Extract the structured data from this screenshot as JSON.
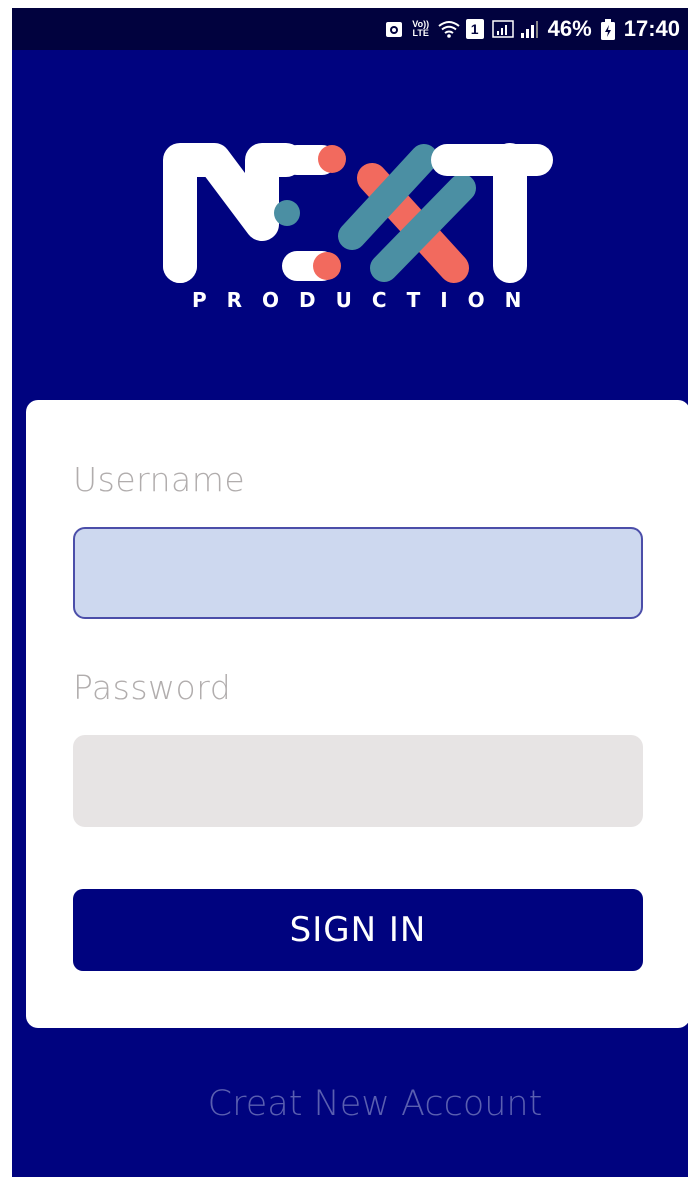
{
  "status_bar": {
    "battery_percent": "46%",
    "time": "17:40",
    "volte_label_top": "Vo))",
    "volte_label_bottom": "LTE",
    "sim_label": "1",
    "icons": [
      "android-notification-icon",
      "volte-icon",
      "wifi-icon",
      "sim-icon",
      "signal-box-icon",
      "signal-bars-icon",
      "battery-icon"
    ]
  },
  "logo": {
    "wordmark": "NEXT",
    "subtitle": "PRODUCTION",
    "colors": {
      "white": "#ffffff",
      "coral": "#f26a5e",
      "teal": "#4b8fa3"
    }
  },
  "form": {
    "username_label": "Username",
    "username_value": "",
    "password_label": "Password",
    "password_value": "",
    "signin_label": "SIGN IN"
  },
  "footer": {
    "create_account_label": "Creat New Account"
  },
  "colors": {
    "background": "#00037f",
    "status_bar": "#01023e",
    "username_field": "#cdd8ef",
    "password_field": "#e7e4e4",
    "label_text": "#b1adad",
    "link_text": "#5a5fb0"
  }
}
